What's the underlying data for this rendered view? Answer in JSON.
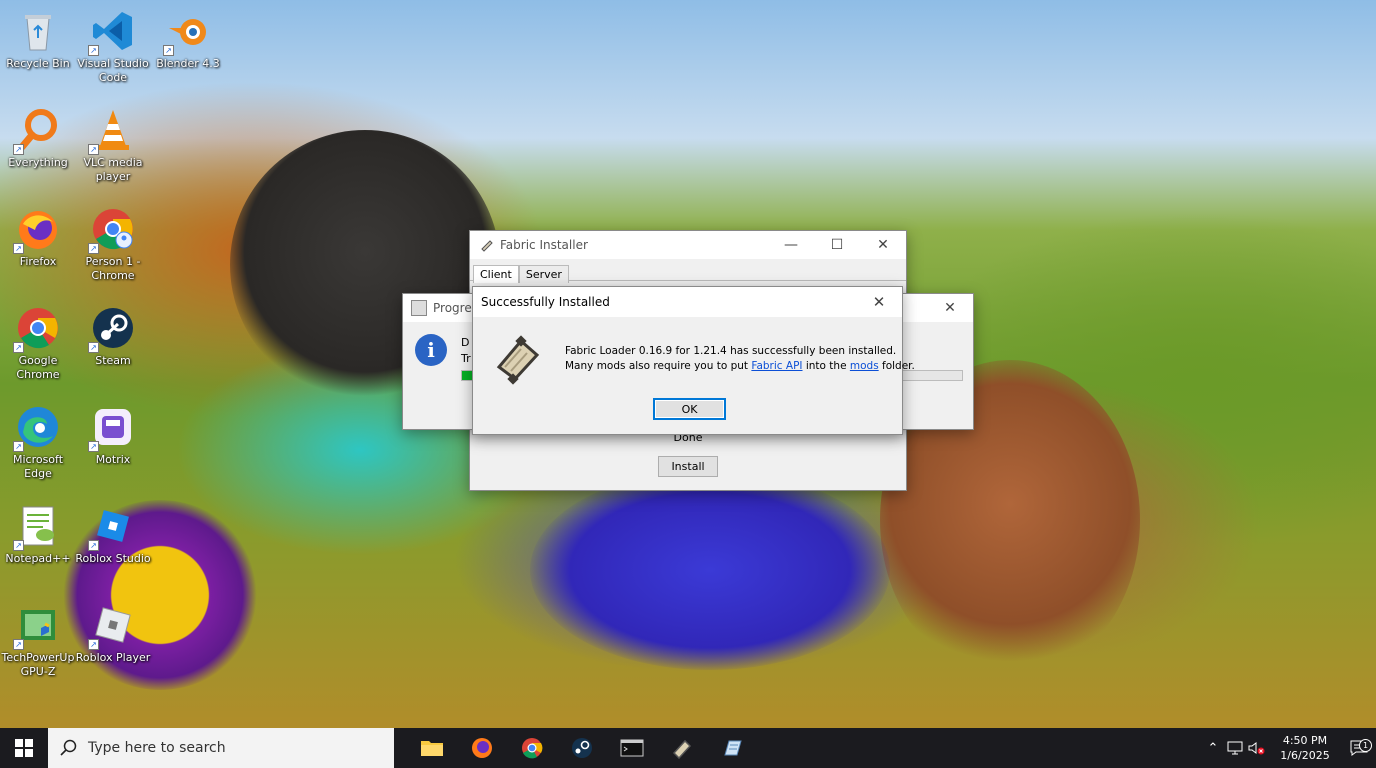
{
  "desktop": {
    "icons": [
      {
        "label": "Recycle Bin"
      },
      {
        "label": "Visual Studio Code"
      },
      {
        "label": "Blender 4.3"
      },
      {
        "label": "Everything"
      },
      {
        "label": "VLC media player"
      },
      {
        "label": "Firefox"
      },
      {
        "label": "Person 1 - Chrome"
      },
      {
        "label": "Google Chrome"
      },
      {
        "label": "Steam"
      },
      {
        "label": "Microsoft Edge"
      },
      {
        "label": "Motrix"
      },
      {
        "label": "Notepad++"
      },
      {
        "label": "Roblox Studio"
      },
      {
        "label": "TechPowerUp GPU-Z"
      },
      {
        "label": "Roblox Player"
      }
    ]
  },
  "fabric_window": {
    "title": "Fabric Installer",
    "tabs": [
      "Client",
      "Server"
    ],
    "status_text": "Done",
    "install_label": "Install"
  },
  "progress_window": {
    "title": "Progre",
    "line1": "D",
    "line2": "Tr",
    "progress_fraction": 0.85
  },
  "dialog": {
    "title": "Successfully Installed",
    "message_line1": "Fabric Loader 0.16.9 for 1.21.4 has successfully been installed.",
    "message_line2_prefix": "Many mods also require you to put ",
    "link1": "Fabric API",
    "message_line2_mid": " into the ",
    "link2": "mods",
    "message_line2_suffix": " folder.",
    "ok_label": "OK"
  },
  "taskbar": {
    "search_placeholder": "Type here to search",
    "time": "4:50 PM",
    "date": "1/6/2025",
    "notification_count": "1"
  }
}
